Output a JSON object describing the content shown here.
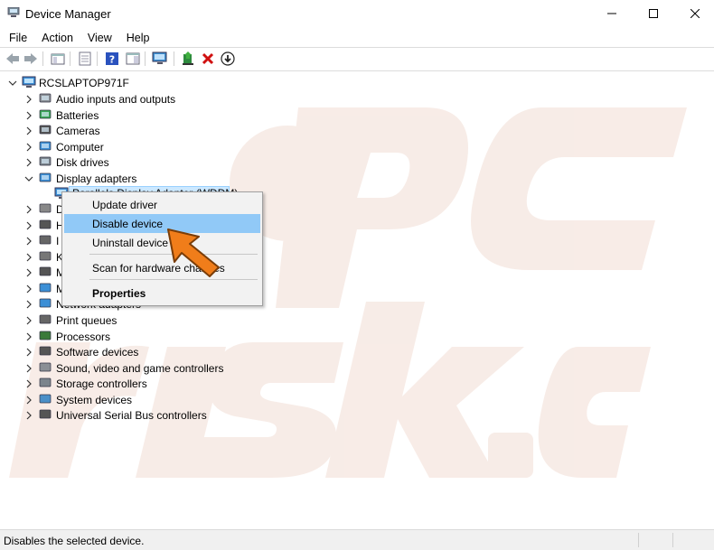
{
  "window": {
    "title": "Device Manager"
  },
  "menu": [
    "File",
    "Action",
    "View",
    "Help"
  ],
  "toolbar": {
    "icons": [
      "back-icon",
      "forward-icon",
      "show-hide-tree-icon",
      "properties-icon",
      "help-icon",
      "action-pane-icon",
      "scan-hardware-icon",
      "update-driver-icon",
      "uninstall-icon",
      "disable-icon"
    ]
  },
  "tree": {
    "root": "RCSLAPTOP971F",
    "categories": [
      "Audio inputs and outputs",
      "Batteries",
      "Cameras",
      "Computer",
      "Disk drives",
      "Display adapters"
    ],
    "selected_device": "Parallels Display Adapter (WDDM)",
    "partial_rows": [
      "D",
      "H",
      "I",
      "K",
      "M",
      "M"
    ],
    "network_row": "Network adapters",
    "categories_after": [
      "Print queues",
      "Processors",
      "Software devices",
      "Sound, video and game controllers",
      "Storage controllers",
      "System devices",
      "Universal Serial Bus controllers"
    ]
  },
  "context_menu": {
    "items": [
      "Update driver",
      "Disable device",
      "Uninstall device",
      "Scan for hardware changes",
      "Properties"
    ],
    "highlighted": "Disable device"
  },
  "status": {
    "text": "Disables the selected device."
  },
  "colors": {
    "highlight": "#91c9f7",
    "selection": "#cce8ff",
    "arrow": "#f07d1a",
    "watermark": "#f3e3dc"
  }
}
